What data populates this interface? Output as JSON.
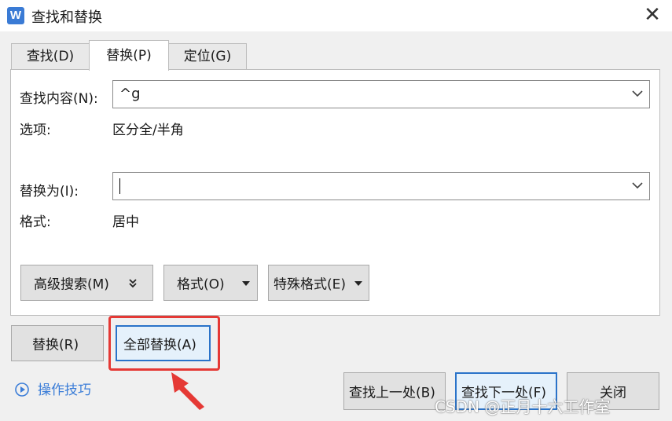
{
  "window": {
    "title": "查找和替换",
    "app_icon_letter": "W"
  },
  "tabs": [
    {
      "label": "查找(D)",
      "active": false
    },
    {
      "label": "替换(P)",
      "active": true
    },
    {
      "label": "定位(G)",
      "active": false
    }
  ],
  "find": {
    "label": "查找内容(N):",
    "value": "^g"
  },
  "find_options": {
    "label": "选项:",
    "value": "区分全/半角"
  },
  "replace": {
    "label": "替换为(I):",
    "value": ""
  },
  "replace_format": {
    "label": "格式:",
    "value": "居中"
  },
  "panel_buttons": {
    "advanced": "高级搜索(M)",
    "format": "格式(O)",
    "special": "特殊格式(E)"
  },
  "actions": {
    "replace": "替换(R)",
    "replace_all": "全部替换(A)",
    "find_prev": "查找上一处(B)",
    "find_next": "查找下一处(F)",
    "close": "关闭"
  },
  "tips": "操作技巧",
  "watermark": "CSDN @正月十六工作室",
  "colors": {
    "accent": "#2a73c9",
    "annotation": "#e53935",
    "link": "#3b7dd8"
  }
}
